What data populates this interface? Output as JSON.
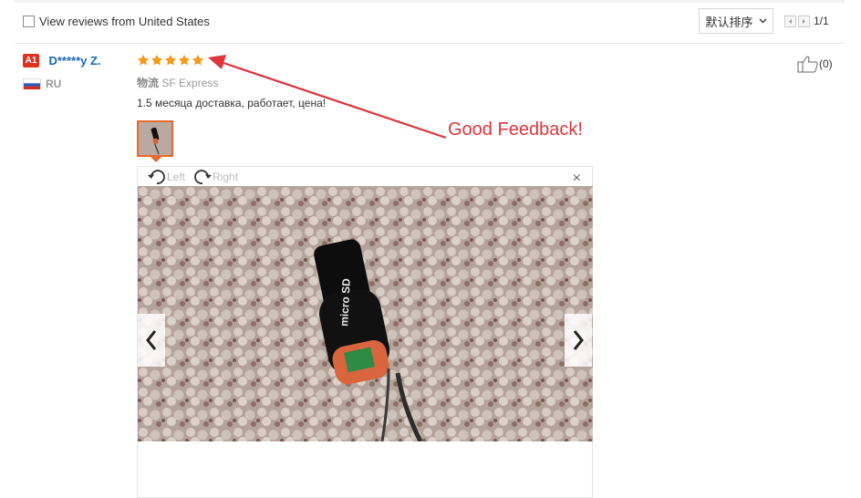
{
  "filter": {
    "label": "View reviews from United States",
    "checked": false
  },
  "sort": {
    "label": "默认排序"
  },
  "pager": {
    "text": "1/1"
  },
  "review": {
    "level_badge": "A1",
    "username": "D*****y Z.",
    "country": "RU",
    "rating": 5,
    "logistics_label": "物流",
    "logistics_value": "SF Express",
    "text": "1.5 месяца доставка, работает, цена!",
    "likes": "(0)"
  },
  "viewer": {
    "rotate_left": "Left",
    "rotate_right": "Right",
    "close": "×"
  },
  "annotation": {
    "text": "Good Feedback!"
  },
  "colors": {
    "accent_red": "#e0353b",
    "star_orange": "#f39a1b",
    "link_blue": "#1769b7"
  },
  "icons": [
    "checkbox-icon",
    "chevron-down-icon",
    "prev-page-icon",
    "next-page-icon",
    "star-icon",
    "thumbs-up-icon",
    "rotate-left-icon",
    "rotate-right-icon",
    "close-icon",
    "chevron-left-icon",
    "chevron-right-icon"
  ]
}
